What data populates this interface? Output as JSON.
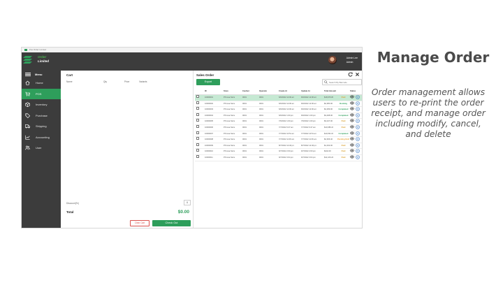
{
  "app": {
    "window_title": "Pos Order Limited",
    "brand_line1": "Order",
    "brand_line2": "Limited",
    "user_name": "Admin Lee",
    "user_role": "Admin"
  },
  "sidebar": {
    "menu_label": "Menu",
    "items": [
      {
        "label": "Home",
        "icon": "home-icon",
        "active": false
      },
      {
        "label": "POS",
        "icon": "cart-icon",
        "active": true
      },
      {
        "label": "Inventory",
        "icon": "box-icon",
        "active": false
      },
      {
        "label": "Purchase",
        "icon": "tag-icon",
        "active": false
      },
      {
        "label": "Shipping",
        "icon": "truck-icon",
        "active": false
      },
      {
        "label": "Accounting",
        "icon": "chart-icon",
        "active": false
      },
      {
        "label": "User",
        "icon": "users-icon",
        "active": false
      }
    ]
  },
  "cart": {
    "title": "Cart",
    "columns": [
      "Name",
      "Qty",
      "Price",
      "Variants"
    ],
    "discount_label": "Discount(%)",
    "discount_value": "0",
    "total_label": "Total",
    "total_value": "$0.00",
    "clear_label": "Clear Cart",
    "checkout_label": "Check Out"
  },
  "sales_order": {
    "title": "Sales Order",
    "export_label": "Export",
    "search_placeholder": "Search By Barcode",
    "columns": [
      "ID",
      "Store",
      "Cashier",
      "Operator",
      "Create At",
      "Update At",
      "Total Amount",
      "Status"
    ],
    "rows": [
      {
        "id": "10000001",
        "store": "PS Hua Store",
        "cashier": "0001",
        "operator": "0001",
        "created": "6/6/2022 12:00 am",
        "updated": "6/6/2022 12:00 am",
        "amount": "$18,976.80",
        "status": "Paid",
        "status_class": "st-paid",
        "highlight": true
      },
      {
        "id": "10000002",
        "store": "PS Hua Store",
        "cashier": "0001",
        "operator": "0001",
        "created": "6/6/2022 12:00 am",
        "updated": "6/6/2022 12:00 am",
        "amount": "$2,380.00",
        "status": "Booking",
        "status_class": "st-booking",
        "highlight": false
      },
      {
        "id": "10000003",
        "store": "PS Hua Store",
        "cashier": "0001",
        "operator": "0001",
        "created": "6/6/2022 12:00 am",
        "updated": "6/6/2022 12:00 am",
        "amount": "$2,489.00",
        "status": "Completed",
        "status_class": "st-completed",
        "highlight": false
      },
      {
        "id": "10000004",
        "store": "PS Hua Store",
        "cashier": "0001",
        "operator": "0001",
        "created": "6/6/2022 1:00 pm",
        "updated": "6/6/2022 1:00 pm",
        "amount": "$3,298.00",
        "status": "Completed",
        "status_class": "st-completed",
        "highlight": false
      },
      {
        "id": "10000005",
        "store": "PS Hua Store",
        "cashier": "0001",
        "operator": "0001",
        "created": "7/6/2022 1:00 pm",
        "updated": "7/6/2022 1:00 pm",
        "amount": "$3,247.00",
        "status": "Paid",
        "status_class": "st-paid",
        "highlight": false
      },
      {
        "id": "10000006",
        "store": "PS Hua Store",
        "cashier": "0001",
        "operator": "0001",
        "created": "7/7/2022 9:47 am",
        "updated": "7/7/2022 9:47 am",
        "amount": "$10,686.20",
        "status": "Paid",
        "status_class": "st-paid",
        "highlight": false
      },
      {
        "id": "10000007",
        "store": "PS Hua Store",
        "cashier": "0001",
        "operator": "0001",
        "created": "7/7/2022 10:51 am",
        "updated": "7/7/2022 10:51 am",
        "amount": "$10,691.00",
        "status": "Completed",
        "status_class": "st-completed",
        "highlight": false
      },
      {
        "id": "10000008",
        "store": "PS Hua Store",
        "cashier": "0001",
        "operator": "0001",
        "created": "7/7/2022 11:06 am",
        "updated": "7/7/2022 11:06 am",
        "amount": "$2,366.40",
        "status": "Pending Delivery",
        "status_class": "st-pending",
        "highlight": false
      },
      {
        "id": "10000009",
        "store": "PS Hua Store",
        "cashier": "0001",
        "operator": "0001",
        "created": "8/7/2022 12:46 pm",
        "updated": "8/7/2022 12:46 pm",
        "amount": "$1,332.00",
        "status": "Paid",
        "status_class": "st-paid",
        "highlight": false
      },
      {
        "id": "10000010",
        "store": "PS Hua Store",
        "cashier": "0001",
        "operator": "0001",
        "created": "9/7/2022 2:00 pm",
        "updated": "9/7/2022 2:00 pm",
        "amount": "$444.00",
        "status": "Paid",
        "status_class": "st-paid",
        "highlight": false
      },
      {
        "id": "10000011",
        "store": "PS Hua Store",
        "cashier": "0001",
        "operator": "0001",
        "created": "9/7/2022 3:04 pm",
        "updated": "9/7/2022 3:04 pm",
        "amount": "$11,106.20",
        "status": "Paid",
        "status_class": "st-paid",
        "highlight": false
      }
    ]
  },
  "caption": {
    "title": "Manage Order",
    "description": "Order management allows users to re-print the order receipt, and manage order including modify, cancel, and delete"
  },
  "colors": {
    "accent": "#2e9e5b",
    "sidebar_bg": "#3c3c3c",
    "highlight_row": "#c6e9d3",
    "danger": "#d9534f"
  }
}
